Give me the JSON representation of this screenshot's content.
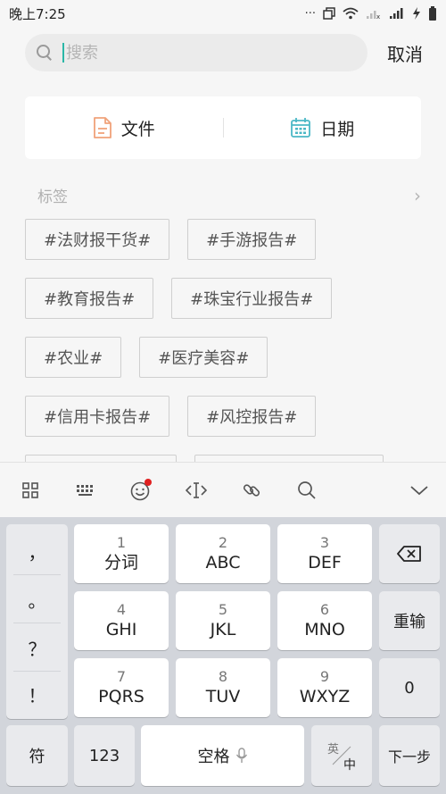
{
  "status": {
    "time": "晚上7:25",
    "dots": "···"
  },
  "search": {
    "placeholder": "搜索",
    "cancel_label": "取消"
  },
  "filters": {
    "file_label": "文件",
    "date_label": "日期"
  },
  "tags_section": {
    "title": "标签",
    "more": "›",
    "tags": [
      [
        "#法财报干货#",
        "#手游报告#"
      ],
      [
        "#教育报告#",
        "#珠宝行业报告#"
      ],
      [
        "#农业#",
        "#医疗美容#"
      ],
      [
        "#信用卡报告#",
        "#风控报告#"
      ]
    ]
  },
  "keyboard": {
    "punctuation": [
      "，",
      "。",
      "？",
      "！"
    ],
    "keys": [
      {
        "num": "1",
        "label": "分词"
      },
      {
        "num": "2",
        "label": "ABC"
      },
      {
        "num": "3",
        "label": "DEF"
      },
      {
        "num": "4",
        "label": "GHI"
      },
      {
        "num": "5",
        "label": "JKL"
      },
      {
        "num": "6",
        "label": "MNO"
      },
      {
        "num": "7",
        "label": "PQRS"
      },
      {
        "num": "8",
        "label": "TUV"
      },
      {
        "num": "9",
        "label": "WXYZ"
      }
    ],
    "reinput": "重输",
    "zero": "0",
    "symbol": "符",
    "num123": "123",
    "space": "空格",
    "lang_en": "英",
    "lang_zh": "中",
    "next": "下一步"
  },
  "colors": {
    "accent": "#2bb7a7",
    "file_icon": "#f0a27a",
    "date_icon": "#4bb8c6",
    "badge": "#e02020"
  }
}
